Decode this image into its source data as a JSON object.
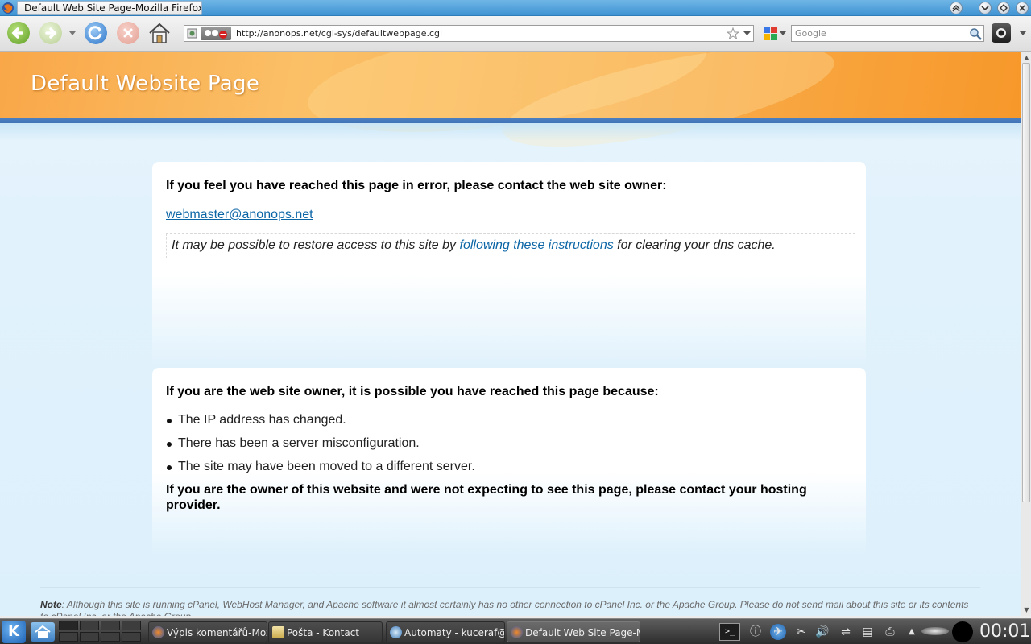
{
  "window": {
    "title": "Default Web Site Page-Mozilla Firefox"
  },
  "navbar": {
    "url": "http://anonops.net/cgi-sys/defaultwebpage.cgi",
    "search_placeholder": "Google"
  },
  "page": {
    "header_title": "Default Website Page",
    "card1": {
      "heading": "If you feel you have reached this page in error, please contact the web site owner:",
      "email": "webmaster@anonops.net",
      "note_before": "It may be possible to restore access to this site by",
      "note_link": "following these instructions",
      "note_after": "for clearing your dns cache."
    },
    "card2": {
      "heading": "If you are the web site owner, it is possible you have reached this page because:",
      "reasons": [
        "The IP address has changed.",
        "There has been a server misconfiguration.",
        "The site may have been moved to a different server."
      ],
      "owner_note": "If you are the owner of this website and were not expecting to see this page, please contact your hosting provider."
    },
    "footer": {
      "label": "Note",
      "text": ": Although this site is running cPanel, WebHost Manager, and Apache software it almost certainly has no other connection to cPanel Inc. or the Apache Group. Please do not send mail about this site or its contents to cPanel Inc. or the Apache Group."
    }
  },
  "taskbar": {
    "tasks": [
      "Výpis komentářů-Mozi",
      "Pošta - Kontact",
      "Automaty - kuceraf@v",
      "Default Web Site Page-M"
    ],
    "clock": "00:01"
  },
  "colors": {
    "header_orange": "#f9a748",
    "link_blue": "#0c66a6",
    "strip_blue": "#4b7fc0"
  }
}
